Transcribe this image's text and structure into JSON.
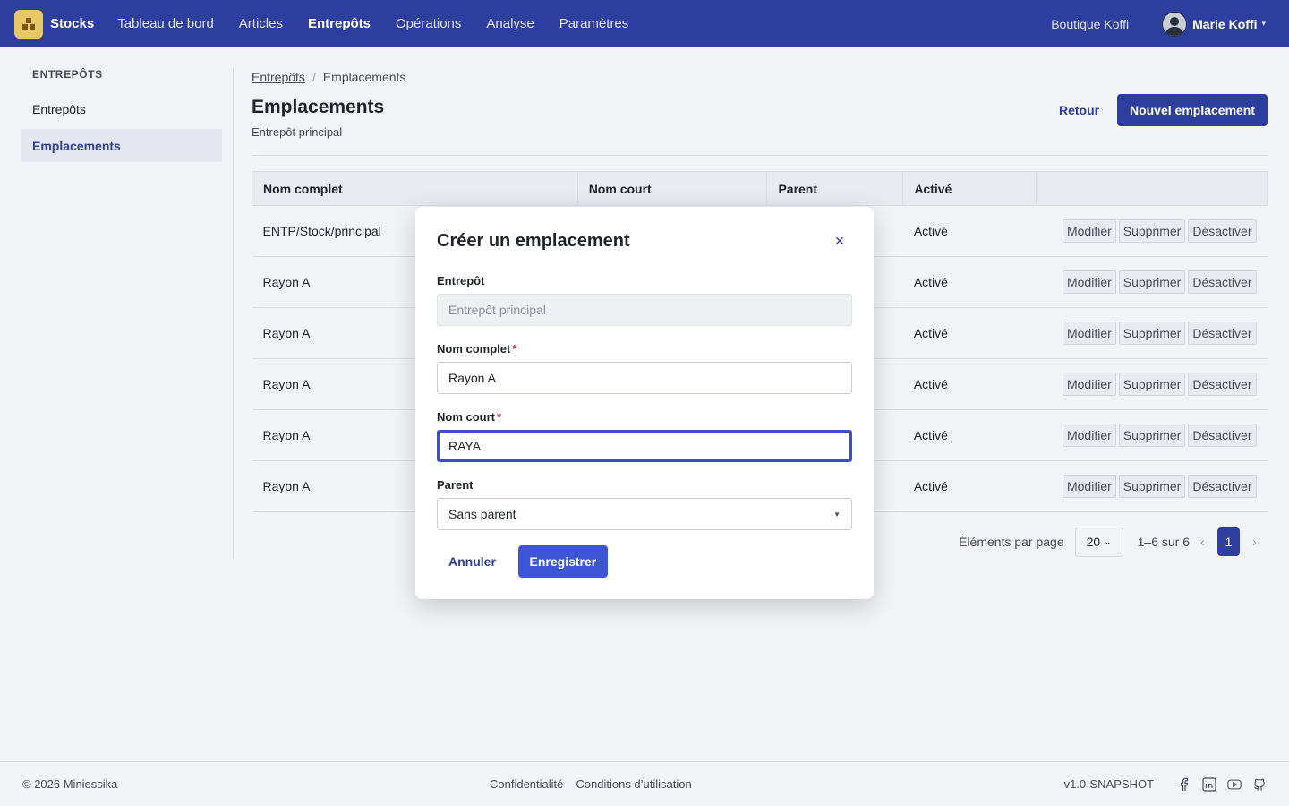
{
  "app": {
    "brand": "Stocks",
    "logo_icon": "warehouse-boxes-icon"
  },
  "nav": {
    "items": [
      "Tableau de bord",
      "Articles",
      "Entrepôts",
      "Opérations",
      "Analyse",
      "Paramètres"
    ],
    "active": "Entrepôts",
    "shop": "Boutique Koffi",
    "user": "Marie Koffi"
  },
  "sidebar": {
    "title": "ENTREPÔTS",
    "items": [
      {
        "label": "Entrepôts"
      },
      {
        "label": "Emplacements"
      }
    ],
    "active": "Emplacements"
  },
  "breadcrumb": {
    "parent": "Entrepôts",
    "current": "Emplacements"
  },
  "page": {
    "title": "Emplacements",
    "subtitle": "Entrepôt principal",
    "back_label": "Retour",
    "new_label": "Nouvel emplacement"
  },
  "table": {
    "columns": [
      "Nom complet",
      "Nom court",
      "Parent",
      "Activé",
      ""
    ],
    "rows": [
      {
        "full_name": "ENTP/Stock/principal",
        "status": "Activé"
      },
      {
        "full_name": "Rayon A",
        "status": "Activé"
      },
      {
        "full_name": "Rayon A",
        "status": "Activé"
      },
      {
        "full_name": "Rayon A",
        "status": "Activé"
      },
      {
        "full_name": "Rayon A",
        "status": "Activé"
      },
      {
        "full_name": "Rayon A",
        "status": "Activé"
      }
    ],
    "actions": [
      "Modifier",
      "Supprimer",
      "Désactiver"
    ]
  },
  "pagination": {
    "per_page_label": "Éléments par page",
    "per_page": "20",
    "range": "1–6 sur 6",
    "current_page": "1"
  },
  "modal": {
    "title": "Créer un emplacement",
    "fields": {
      "warehouse": {
        "label": "Entrepôt",
        "value": "Entrepôt principal"
      },
      "full_name": {
        "label": "Nom complet",
        "required": "*",
        "value": "Rayon A"
      },
      "short_name": {
        "label": "Nom court",
        "required": "*",
        "value": "RAYA"
      },
      "parent": {
        "label": "Parent",
        "value": "Sans parent"
      }
    },
    "cancel_label": "Annuler",
    "save_label": "Enregistrer"
  },
  "footer": {
    "copyright": "© 2026 Miniessika",
    "links": [
      "Confidentialité",
      "Conditions d’utilisation"
    ],
    "version": "v1.0-SNAPSHOT",
    "social_icons": [
      "facebook-icon",
      "linkedin-icon",
      "youtube-icon",
      "github-icon"
    ]
  },
  "colors": {
    "primary": "#2d3e9f",
    "accent": "#3d55d6",
    "required": "#d21f3c",
    "logo": "#e8c766"
  }
}
